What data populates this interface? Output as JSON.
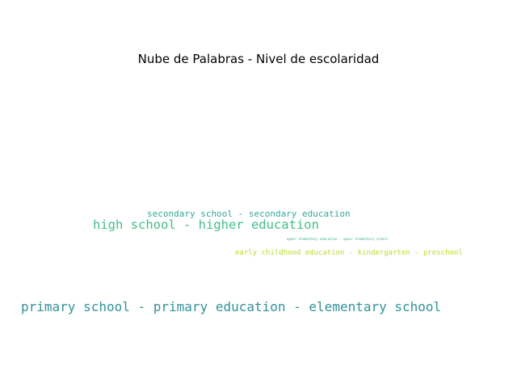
{
  "title": "Nube de Palabras - Nivel de escolaridad",
  "words": [
    {
      "text": "primary school - primary education - elementary school",
      "color": "#31929b"
    },
    {
      "text": "high school - higher education",
      "color": "#3fbf85"
    },
    {
      "text": "secondary school - secondary education",
      "color": "#34a89a"
    },
    {
      "text": "early childhood education - kindergarten - preschool",
      "color": "#b9de28"
    },
    {
      "text": "upper elementary education - upper elementary school",
      "color": "#3ab38f"
    }
  ]
}
